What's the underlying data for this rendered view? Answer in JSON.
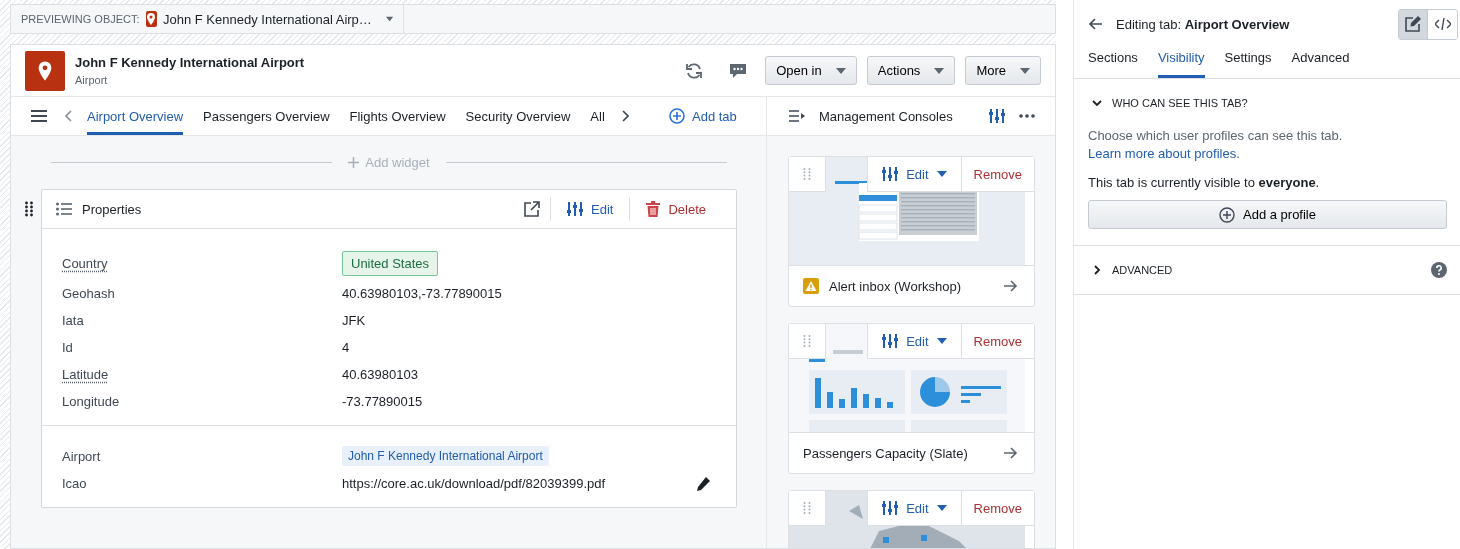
{
  "preview": {
    "label": "PREVIEWING OBJECT:",
    "object": "John F Kennedy International Airp…"
  },
  "object": {
    "title": "John F Kennedy International Airport",
    "type": "Airport"
  },
  "header_buttons": [
    "Open in",
    "Actions",
    "More"
  ],
  "tabs": [
    {
      "label": "Airport Overview",
      "selected": true
    },
    {
      "label": "Passengers Overview",
      "selected": false
    },
    {
      "label": "Flights Overview",
      "selected": false
    },
    {
      "label": "Security Overview",
      "selected": false
    },
    {
      "label": "All",
      "selected": false
    }
  ],
  "add_tab": "Add tab",
  "add_widget": "Add widget",
  "properties": {
    "title": "Properties",
    "edit": "Edit",
    "delete": "Delete",
    "sections": [
      [
        {
          "label": "Country",
          "value": "United States",
          "kind": "tag",
          "described": true
        },
        {
          "label": "Geohash",
          "value": "40.63980103,-73.77890015",
          "kind": "text",
          "described": false
        },
        {
          "label": "Iata",
          "value": "JFK",
          "kind": "text",
          "described": false
        },
        {
          "label": "Id",
          "value": "4",
          "kind": "text",
          "described": false
        },
        {
          "label": "Latitude",
          "value": "40.63980103",
          "kind": "text",
          "described": true
        },
        {
          "label": "Longitude",
          "value": "-73.77890015",
          "kind": "text",
          "described": false
        }
      ],
      [
        {
          "label": "Airport",
          "value": "John F Kennedy International Airport",
          "kind": "link",
          "described": false
        },
        {
          "label": "Icao",
          "value": "https://core.ac.uk/download/pdf/82039399.pdf",
          "kind": "editable",
          "described": false
        }
      ]
    ]
  },
  "consoles": {
    "title": "Management Consoles",
    "cards": [
      {
        "kind": "table",
        "title": "Alert inbox (Workshop)",
        "warning": true,
        "edit": "Edit",
        "remove": "Remove"
      },
      {
        "kind": "dashboard",
        "title": "Passengers Capacity (Slate)",
        "warning": false,
        "edit": "Edit",
        "remove": "Remove"
      },
      {
        "kind": "map",
        "edit": "Edit",
        "remove": "Remove"
      }
    ]
  },
  "editor": {
    "title": "Editing tab: **Airport Overview**",
    "modes": [
      {
        "kind": "edit",
        "selected": true
      },
      {
        "kind": "code",
        "selected": false
      }
    ],
    "tabs": [
      {
        "label": "Sections",
        "selected": false
      },
      {
        "label": "Visibility",
        "selected": true
      },
      {
        "label": "Settings",
        "selected": false
      },
      {
        "label": "Advanced",
        "selected": false
      }
    ],
    "sections": [
      {
        "title": "WHO CAN SEE THIS TAB?",
        "expanded": true,
        "help": false,
        "description": "Choose which user profiles can see this tab.",
        "link": "Learn more about profiles",
        "link_suffix": ".",
        "status": "This tab is currently visible to **everyone**.",
        "button": "Add a profile"
      },
      {
        "title": "ADVANCED",
        "expanded": false,
        "help": true
      }
    ]
  }
}
